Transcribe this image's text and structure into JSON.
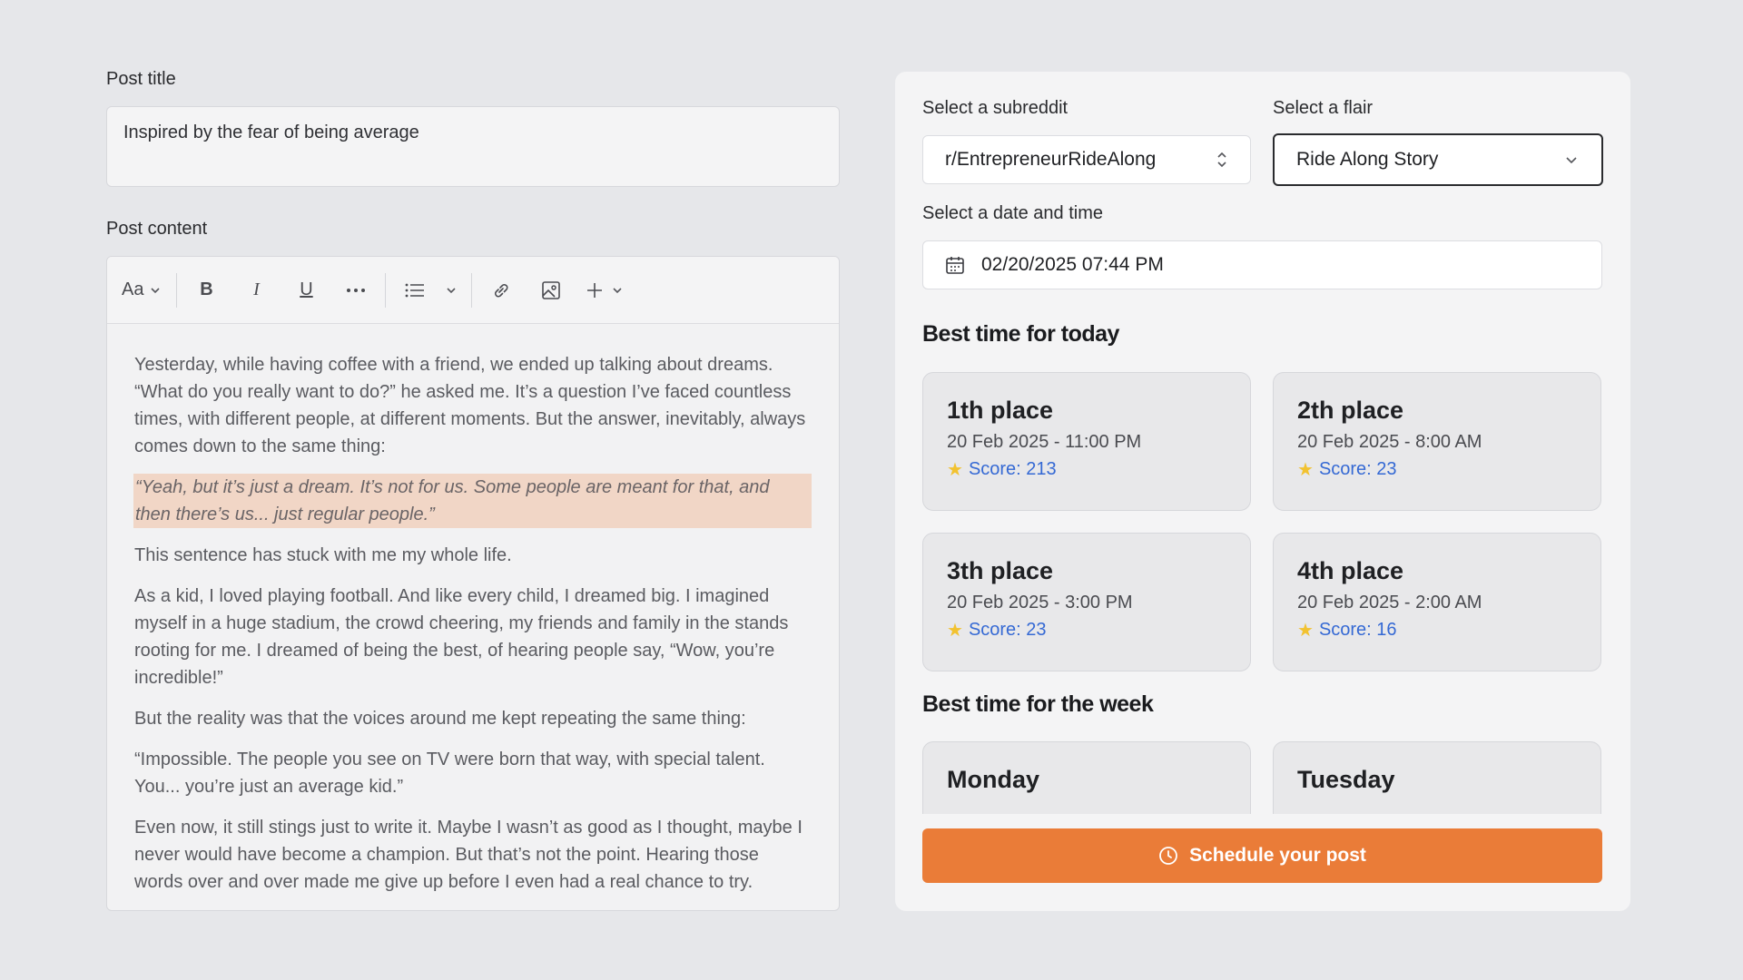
{
  "post_title": {
    "label": "Post title",
    "value": "Inspired by the fear of being average"
  },
  "post_content": {
    "label": "Post content",
    "toolbar": {
      "font_style_label": "Aa",
      "bold_label": "B",
      "italic_label": "I",
      "underline_label": "U"
    },
    "paragraphs": [
      "Yesterday, while having coffee with a friend, we ended up talking about dreams. “What do you really want to do?” he asked me. It’s a question I’ve faced countless times, with different people, at different moments. But the answer, inevitably, always comes down to the same thing:",
      "“Yeah, but it’s just a dream. It’s not for us. Some people are meant for that, and then there’s us... just regular people.”",
      "This sentence has stuck with me my whole life.",
      "As a kid, I loved playing football. And like every child, I dreamed big. I imagined myself in a huge stadium, the crowd cheering, my friends and family in the stands rooting for me. I dreamed of being the best, of hearing people say, “Wow, you’re incredible!”",
      "But the reality was that the voices around me kept repeating the same thing:",
      "“Impossible. The people you see on TV were born that way, with special talent. You... you’re just an average kid.”",
      "Even now, it still stings just to write it. Maybe I wasn’t as good as I thought, maybe I never would have become a champion. But that’s not the point. Hearing those words over and over made me give up before I even had a real chance to try."
    ]
  },
  "subreddit": {
    "label": "Select a subreddit",
    "value": "r/EntrepreneurRideAlong"
  },
  "flair": {
    "label": "Select a flair",
    "value": "Ride Along Story"
  },
  "datetime": {
    "label": "Select a date and time",
    "value": "02/20/2025 07:44 PM"
  },
  "best_today": {
    "title": "Best time for today",
    "cards": [
      {
        "place": "1th place",
        "date": "20 Feb 2025 - 11:00 PM",
        "score": "Score: 213"
      },
      {
        "place": "2th place",
        "date": "20 Feb 2025 - 8:00 AM",
        "score": "Score: 23"
      },
      {
        "place": "3th place",
        "date": "20 Feb 2025 - 3:00 PM",
        "score": "Score: 23"
      },
      {
        "place": "4th place",
        "date": "20 Feb 2025 - 2:00 AM",
        "score": "Score: 16"
      }
    ]
  },
  "best_week": {
    "title": "Best time for the week",
    "days": [
      "Monday",
      "Tuesday"
    ]
  },
  "schedule_button": {
    "label": "Schedule your post"
  },
  "colors": {
    "accent": "#ea7c38",
    "score": "#3569d4",
    "highlight": "#f1d6c6",
    "star": "#f2c230"
  }
}
